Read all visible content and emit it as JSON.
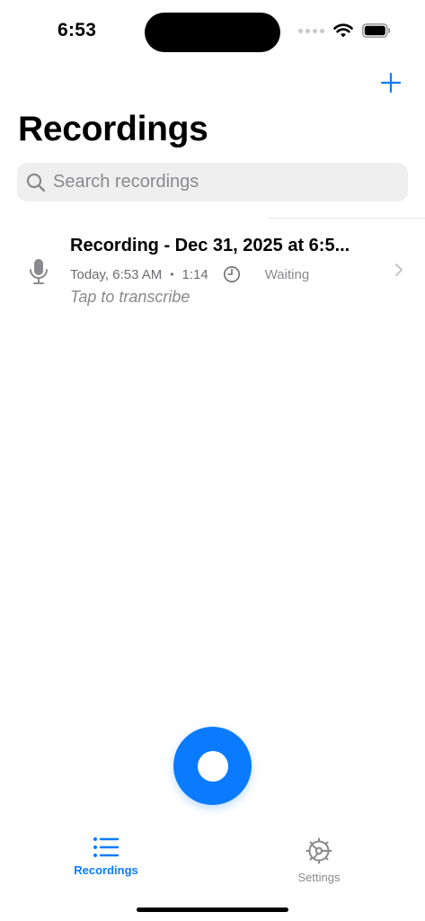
{
  "status_bar": {
    "time": "6:53"
  },
  "header": {
    "title": "Recordings",
    "add_icon": "plus-icon"
  },
  "search": {
    "placeholder": "Search recordings",
    "value": ""
  },
  "recordings": [
    {
      "title": "Recording - Dec 31, 2025 at 6:5...",
      "date": "Today, 6:53 AM",
      "separator": "•",
      "duration": "1:14",
      "status": "Waiting",
      "hint": "Tap to transcribe"
    }
  ],
  "tab_bar": {
    "tabs": [
      {
        "label": "Recordings",
        "icon": "list-icon",
        "selected": true
      },
      {
        "label": "Settings",
        "icon": "gear-icon",
        "selected": false
      }
    ]
  },
  "colors": {
    "accent": "#0a7bff",
    "secondary_text": "#8a8a8e",
    "search_bg": "#efefef"
  }
}
